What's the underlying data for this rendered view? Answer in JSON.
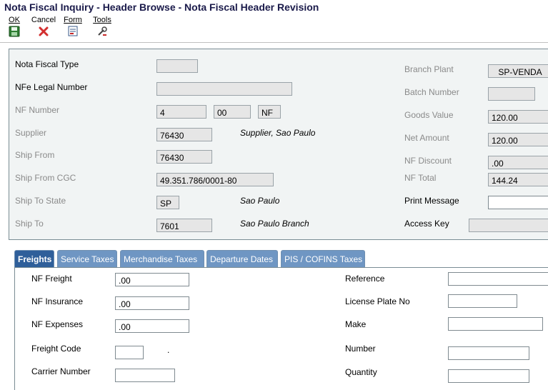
{
  "window": {
    "title": "Nota Fiscal Inquiry - Header Browse - Nota Fiscal Header Revision"
  },
  "toolbar": {
    "ok_label": "OK",
    "cancel_label": "Cancel",
    "form_label": "Form",
    "tools_label": "Tools"
  },
  "header": {
    "nota_fiscal_type_label": "Nota Fiscal Type",
    "nota_fiscal_type_value": "",
    "nfe_legal_number_label": "NFe Legal Number",
    "nfe_legal_number_value": "",
    "nf_number_label": "NF Number",
    "nf_number_value": "4",
    "nf_suffix_value": "00",
    "nf_doc_type_value": "NF",
    "supplier_label": "Supplier",
    "supplier_value": "76430",
    "supplier_name": "Supplier, Sao Paulo",
    "ship_from_label": "Ship From",
    "ship_from_value": "76430",
    "ship_from_cgc_label": "Ship From CGC",
    "ship_from_cgc_value": "49.351.786/0001-80",
    "ship_to_state_label": "Ship To State",
    "ship_to_state_value": "SP",
    "ship_to_state_name": "Sao Paulo",
    "ship_to_label": "Ship To",
    "ship_to_value": "7601",
    "ship_to_name": "Sao Paulo Branch",
    "branch_plant_label": "Branch Plant",
    "branch_plant_value": "SP-VENDA",
    "batch_number_label": "Batch Number",
    "batch_number_value": "",
    "goods_value_label": "Goods Value",
    "goods_value_value": "120.00",
    "net_amount_label": "Net Amount",
    "net_amount_value": "120.00",
    "nf_discount_label": "NF Discount",
    "nf_discount_value": ".00",
    "nf_total_label": "NF Total",
    "nf_total_value": "144.24",
    "print_message_label": "Print Message",
    "print_message_value": "",
    "access_key_label": "Access Key",
    "access_key_value": ""
  },
  "tabs": [
    {
      "label": "Freights",
      "active": true
    },
    {
      "label": "Service Taxes",
      "active": false
    },
    {
      "label": "Merchandise Taxes",
      "active": false
    },
    {
      "label": "Departure Dates",
      "active": false
    },
    {
      "label": "PIS / COFINS Taxes",
      "active": false
    }
  ],
  "freights": {
    "nf_freight_label": "NF Freight",
    "nf_freight_value": ".00",
    "nf_insurance_label": "NF Insurance",
    "nf_insurance_value": ".00",
    "nf_expenses_label": "NF Expenses",
    "nf_expenses_value": ".00",
    "freight_code_label": "Freight Code",
    "freight_code_value": "",
    "freight_code_desc": ".",
    "carrier_number_label": "Carrier Number",
    "carrier_number_value": "",
    "reference_label": "Reference",
    "reference_value": "",
    "license_plate_label": "License Plate No",
    "license_plate_value": "",
    "make_label": "Make",
    "make_value": "",
    "number_label": "Number",
    "number_value": "",
    "quantity_label": "Quantity",
    "quantity_value": ""
  },
  "colors": {
    "tab_active": "#2f5f9a",
    "tab_inactive": "#6f96c3",
    "panel_bg": "#f1f4f4"
  }
}
